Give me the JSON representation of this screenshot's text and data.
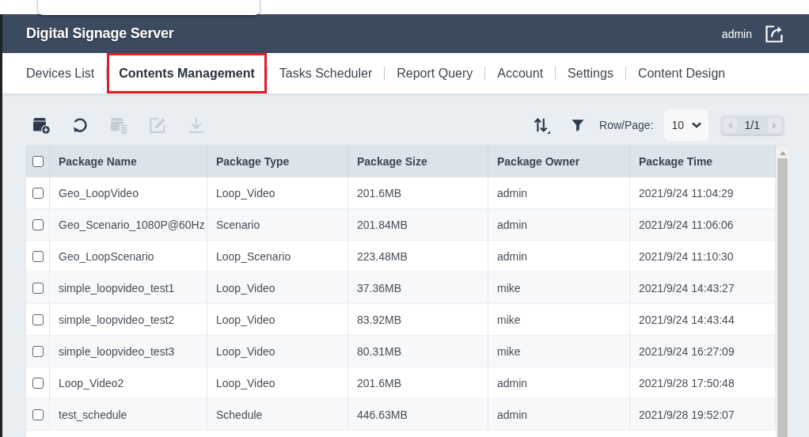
{
  "header": {
    "title": "Digital Signage Server",
    "user": "admin"
  },
  "tabs": [
    {
      "label": "Devices List",
      "selected": false,
      "highlighted": false
    },
    {
      "label": "Contents Management",
      "selected": true,
      "highlighted": true
    },
    {
      "label": "Tasks Scheduler",
      "selected": false,
      "highlighted": false
    },
    {
      "label": "Report Query",
      "selected": false,
      "highlighted": false
    },
    {
      "label": "Account",
      "selected": false,
      "highlighted": false
    },
    {
      "label": "Settings",
      "selected": false,
      "highlighted": false
    },
    {
      "label": "Content Design",
      "selected": false,
      "highlighted": false
    }
  ],
  "toolbar": {
    "actions": [
      {
        "kind": "add-package",
        "disabled": false
      },
      {
        "kind": "refresh",
        "disabled": false
      },
      {
        "kind": "delete",
        "disabled": true
      },
      {
        "kind": "edit",
        "disabled": true
      },
      {
        "kind": "download",
        "disabled": true
      }
    ],
    "tools": [
      {
        "kind": "sort"
      },
      {
        "kind": "filter"
      }
    ],
    "rows_per_page": {
      "label": "Row/Page:",
      "value": "10"
    },
    "pager": {
      "page": "1/1",
      "prev_disabled": true,
      "next_disabled": true
    }
  },
  "table": {
    "select_all": {
      "checked": false
    },
    "columns": [
      "Package Name",
      "Package Type",
      "Package Size",
      "Package Owner",
      "Package Time"
    ],
    "rows": [
      {
        "checked": false,
        "cells": [
          "Geo_LoopVideo",
          "Loop_Video",
          "201.6MB",
          "admin",
          "2021/9/24 11:04:29"
        ]
      },
      {
        "checked": false,
        "cells": [
          "Geo_Scenario_1080P@60Hz",
          "Scenario",
          "201.84MB",
          "admin",
          "2021/9/24 11:06:06"
        ]
      },
      {
        "checked": false,
        "cells": [
          "Geo_LoopScenario",
          "Loop_Scenario",
          "223.48MB",
          "admin",
          "2021/9/24 11:10:30"
        ]
      },
      {
        "checked": false,
        "cells": [
          "simple_loopvideo_test1",
          "Loop_Video",
          "37.36MB",
          "mike",
          "2021/9/24 14:43:27"
        ]
      },
      {
        "checked": false,
        "cells": [
          "simple_loopvideo_test2",
          "Loop_Video",
          "83.92MB",
          "mike",
          "2021/9/24 14:43:44"
        ]
      },
      {
        "checked": false,
        "cells": [
          "simple_loopvideo_test3",
          "Loop_Video",
          "80.31MB",
          "mike",
          "2021/9/24 16:27:09"
        ]
      },
      {
        "checked": false,
        "cells": [
          "Loop_Video2",
          "Loop_Video",
          "201.6MB",
          "admin",
          "2021/9/28 17:50:48"
        ]
      },
      {
        "checked": false,
        "cells": [
          "test_schedule",
          "Schedule",
          "446.63MB",
          "admin",
          "2021/9/28 19:52:07"
        ]
      }
    ]
  }
}
